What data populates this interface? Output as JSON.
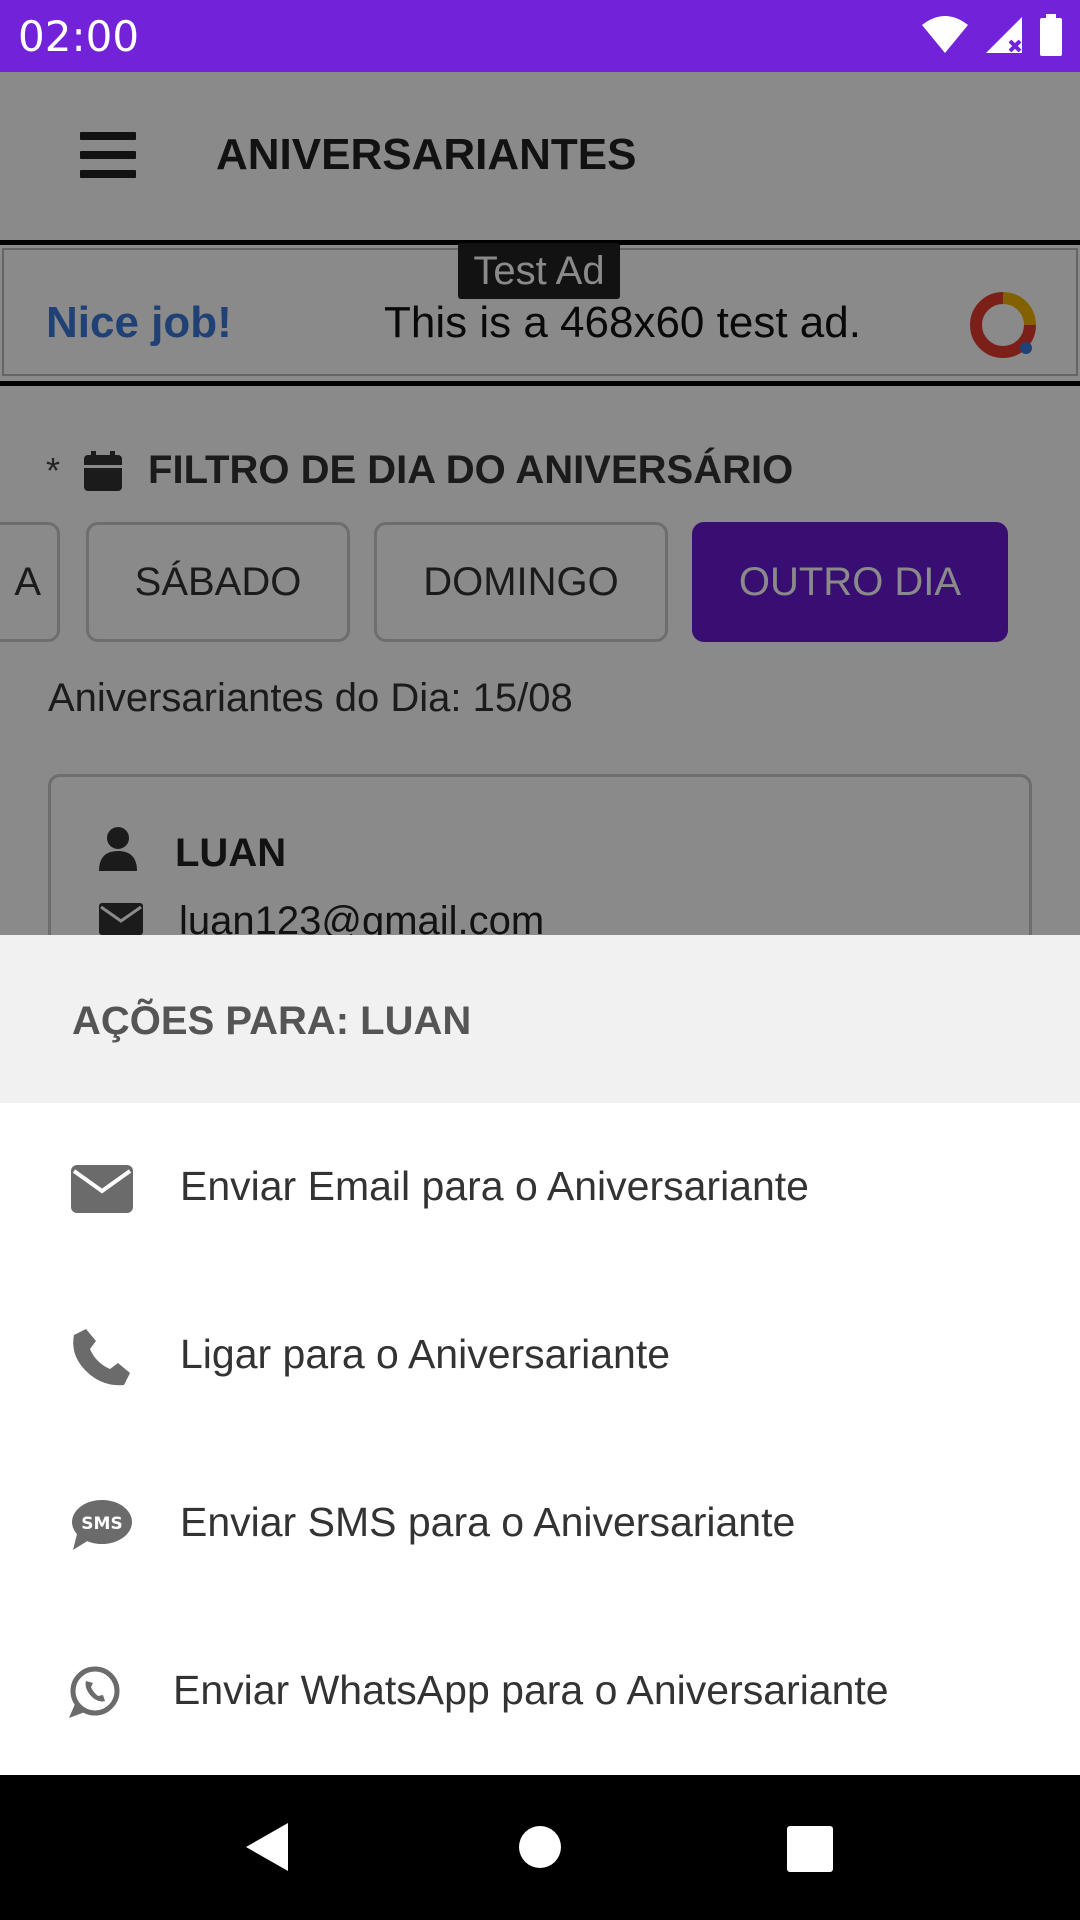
{
  "status_bar": {
    "time": "02:00",
    "icons": [
      "wifi-icon",
      "signal-icon",
      "battery-icon"
    ]
  },
  "toolbar": {
    "title": "ANIVERSARIANTES",
    "menu_icon": "hamburger-menu-icon"
  },
  "ad": {
    "tag": "Test Ad",
    "brand_text": "Nice job!",
    "message": "This is a 468x60 test ad."
  },
  "filter": {
    "required_mark": "*",
    "label": "FILTRO DE DIA DO ANIVERSÁRIO",
    "days": [
      {
        "label": "A",
        "active": false
      },
      {
        "label": "SÁBADO",
        "active": false
      },
      {
        "label": "DOMINGO",
        "active": false
      },
      {
        "label": "OUTRO DIA",
        "active": true
      }
    ],
    "accent_color": "#6a1ad2"
  },
  "list": {
    "day_label": "Aniversariantes do Dia: 15/08",
    "card": {
      "name": "LUAN",
      "email": "luan123@gmail.com"
    }
  },
  "sheet": {
    "title": "AÇÕES PARA: LUAN",
    "actions": [
      {
        "label": "Enviar Email para o Aniversariante",
        "icon": "envelope-icon"
      },
      {
        "label": "Ligar para o Aniversariante",
        "icon": "phone-icon"
      },
      {
        "label": "Enviar SMS para o Aniversariante",
        "icon": "sms-icon"
      },
      {
        "label": "Enviar WhatsApp para o Aniversariante",
        "icon": "whatsapp-icon"
      }
    ]
  },
  "colors": {
    "status_bar": "#7222d9",
    "accent": "#6a1ad2"
  }
}
